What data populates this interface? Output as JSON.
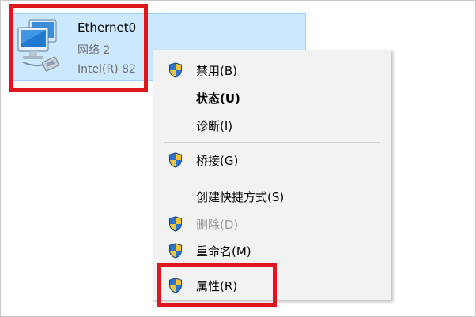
{
  "adapter": {
    "name": "Ethernet0",
    "network": "网络 2",
    "device": "Intel(R) 82"
  },
  "context_menu": {
    "items": [
      {
        "label": "禁用(B)",
        "icon": "uac-shield-icon",
        "enabled": true,
        "bold": false
      },
      {
        "label": "状态(U)",
        "icon": null,
        "enabled": true,
        "bold": true
      },
      {
        "label": "诊断(I)",
        "icon": null,
        "enabled": true,
        "bold": false
      },
      {
        "label": "桥接(G)",
        "icon": "uac-shield-icon",
        "enabled": true,
        "bold": false
      },
      {
        "label": "创建快捷方式(S)",
        "icon": null,
        "enabled": true,
        "bold": false
      },
      {
        "label": "删除(D)",
        "icon": "uac-shield-icon",
        "enabled": false,
        "bold": false
      },
      {
        "label": "重命名(M)",
        "icon": "uac-shield-icon",
        "enabled": true,
        "bold": false
      },
      {
        "label": "属性(R)",
        "icon": "uac-shield-icon",
        "enabled": true,
        "bold": false
      }
    ]
  },
  "colors": {
    "selection_bg": "#cce8ff",
    "highlight_red": "#e0161c",
    "menu_bg": "#f2f2f2",
    "disabled_text": "#9a9a9a"
  }
}
